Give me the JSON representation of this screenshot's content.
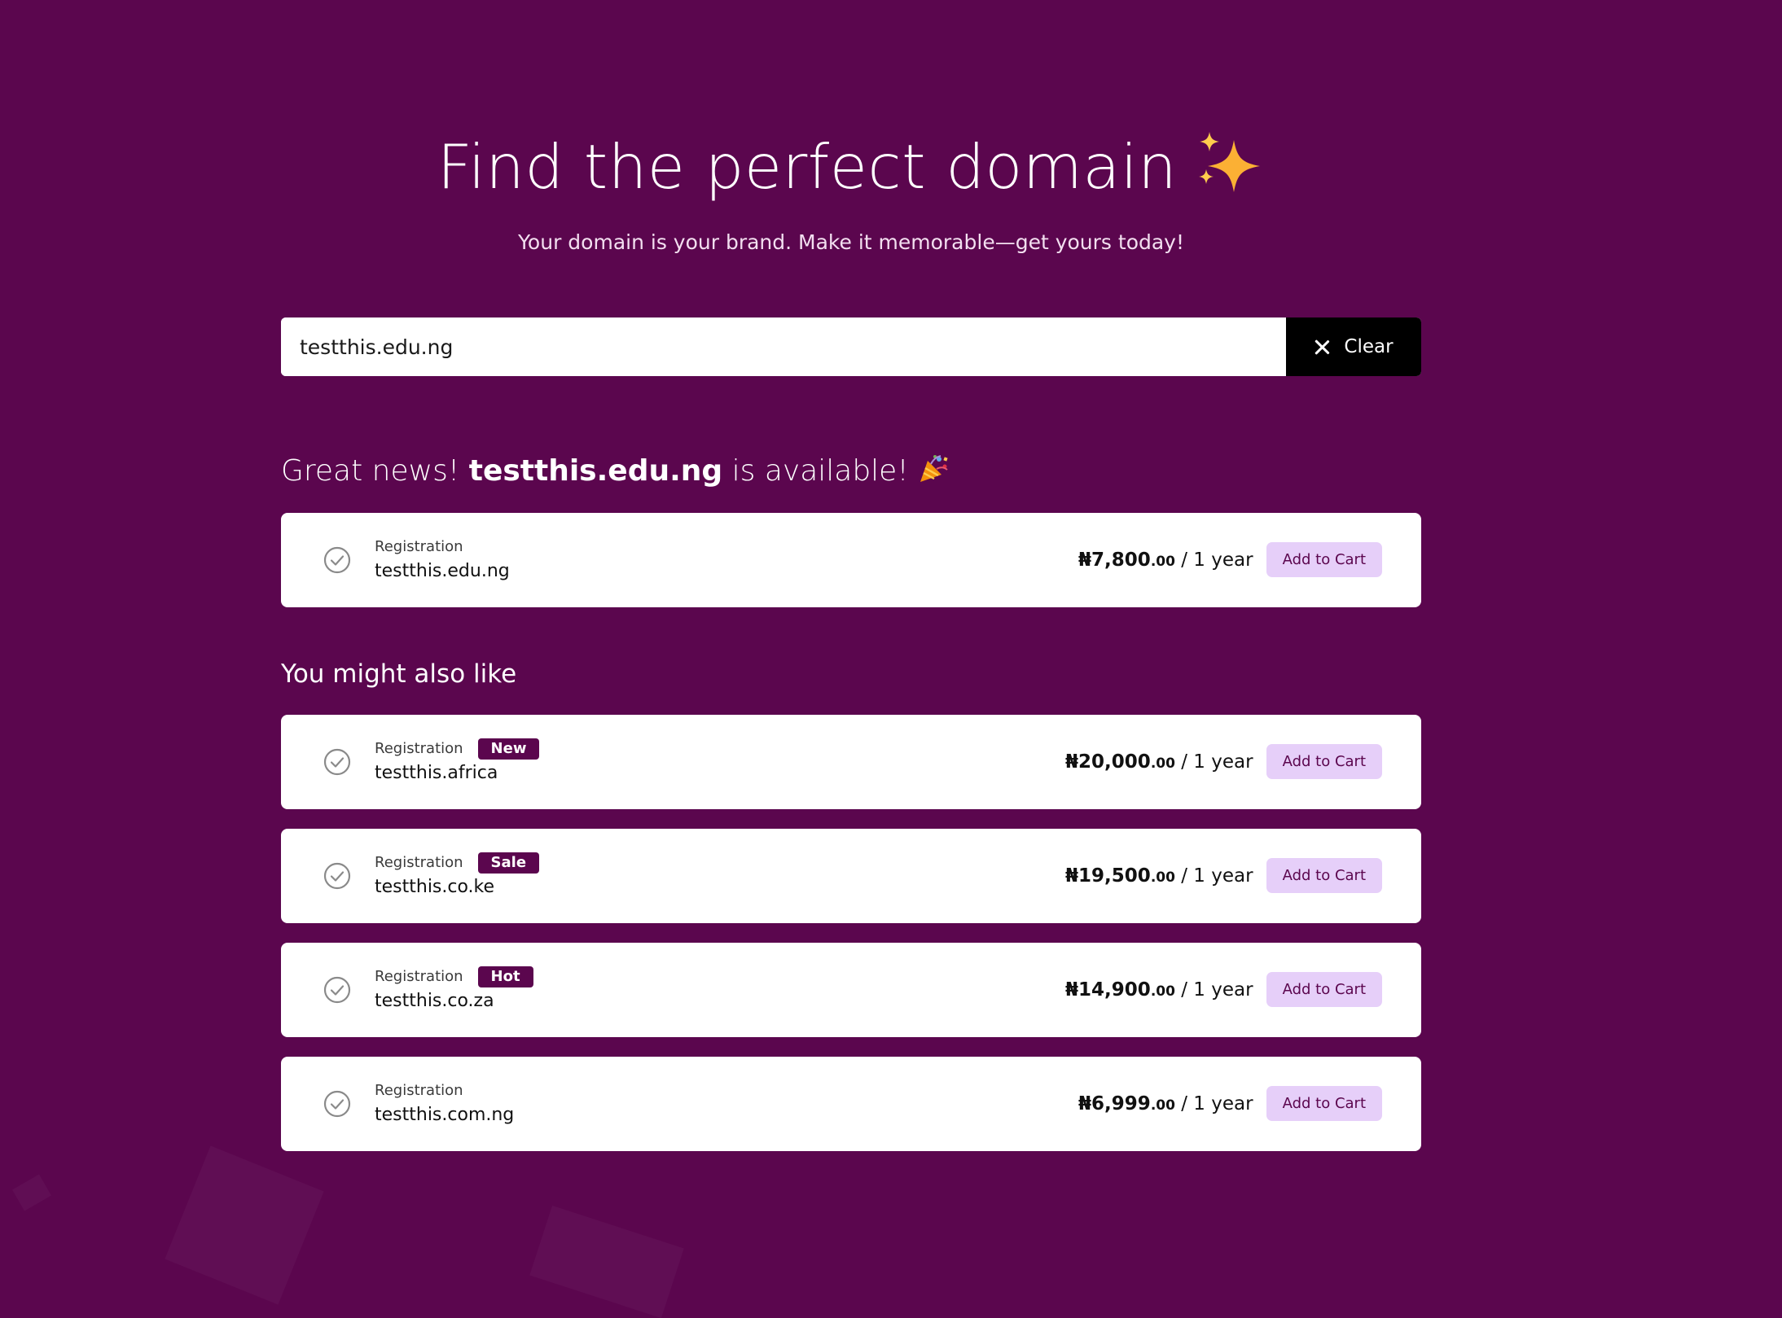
{
  "hero": {
    "title": "Find the perfect domain",
    "subtitle": "Your domain is your brand. Make it memorable—get yours today!"
  },
  "search": {
    "value": "testthis.edu.ng",
    "clear_label": "Clear"
  },
  "availability": {
    "prefix": "Great news!",
    "domain": "testthis.edu.ng",
    "suffix": "is available!"
  },
  "main_result": {
    "type": "Registration",
    "domain": "testthis.edu.ng",
    "price": "₦7,800",
    "cents": ".00",
    "period": "/ 1 year",
    "cta": "Add to Cart"
  },
  "suggestions_title": "You might also like",
  "suggestions": [
    {
      "type": "Registration",
      "badge": "New",
      "domain": "testthis.africa",
      "price": "₦20,000",
      "cents": ".00",
      "period": "/ 1 year",
      "cta": "Add to Cart"
    },
    {
      "type": "Registration",
      "badge": "Sale",
      "domain": "testthis.co.ke",
      "price": "₦19,500",
      "cents": ".00",
      "period": "/ 1 year",
      "cta": "Add to Cart"
    },
    {
      "type": "Registration",
      "badge": "Hot",
      "domain": "testthis.co.za",
      "price": "₦14,900",
      "cents": ".00",
      "period": "/ 1 year",
      "cta": "Add to Cart"
    },
    {
      "type": "Registration",
      "badge": "",
      "domain": "testthis.com.ng",
      "price": "₦6,999",
      "cents": ".00",
      "period": "/ 1 year",
      "cta": "Add to Cart"
    }
  ],
  "colors": {
    "background": "#5b064e",
    "badge": "#5b064e",
    "add_button": "#e6cff9",
    "clear_button": "#000000"
  },
  "icons": {
    "title": "sparkles-icon",
    "availability": "party-popper-icon",
    "card": "check-circle-icon",
    "clear": "close-icon"
  }
}
